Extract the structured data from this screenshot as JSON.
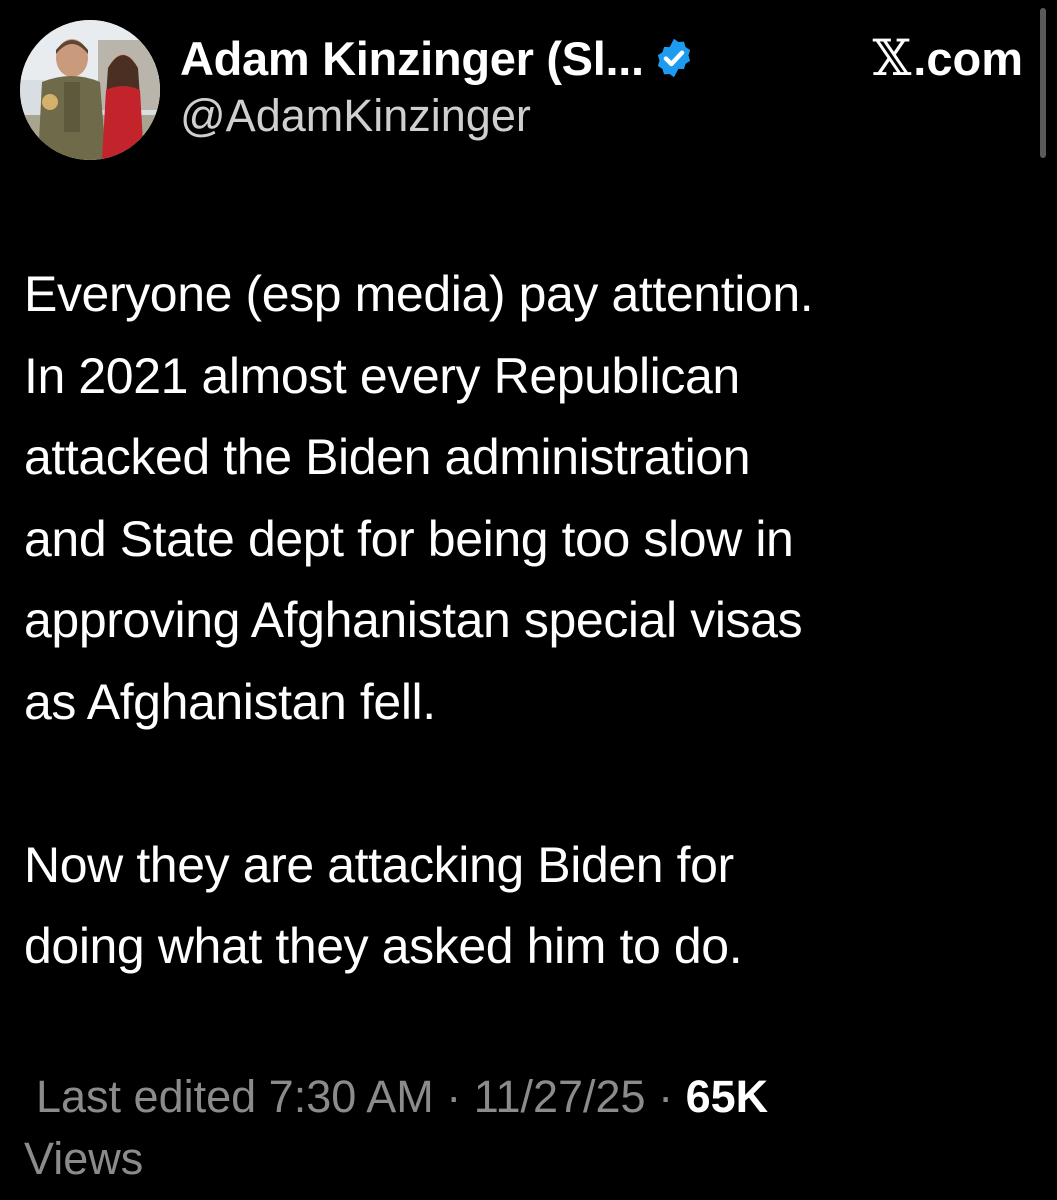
{
  "author": {
    "display_name": "Adam Kinzinger (Sl...",
    "handle": "@AdamKinzinger",
    "verified_icon": "verified-badge-icon",
    "verified_color": "#1d9bf0"
  },
  "source": {
    "x_glyph": "𝕏",
    "label": ".com"
  },
  "tweet": {
    "lines": [
      "Everyone (esp media) pay attention.",
      "In 2021 almost every Republican",
      "attacked the Biden administration",
      "and State dept for being too slow in",
      "approving Afghanistan special visas",
      "as Afghanistan fell."
    ],
    "lines2": [
      "Now they are attacking Biden for",
      "doing what they asked him to do."
    ]
  },
  "meta": {
    "edited_label": "Last edited 7:30 AM · 11/27/25",
    "separator": "·",
    "views_count": "65K",
    "views_label": "Views"
  },
  "colors": {
    "background": "#000000",
    "text": "#ffffff",
    "muted": "#8b8b8b"
  }
}
